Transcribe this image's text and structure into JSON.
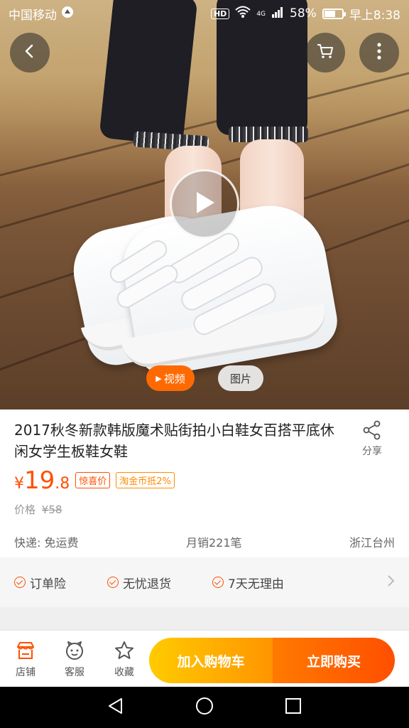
{
  "status_bar": {
    "carrier": "中国移动",
    "hd_badge": "HD",
    "network": "4G",
    "battery": "58%",
    "battery_level": 0.58,
    "time": "早上8:38"
  },
  "media": {
    "video_tab": "视频",
    "photo_tab": "图片"
  },
  "product": {
    "title": "2017秋冬新款韩版魔术贴街拍小白鞋女百搭平底休闲女学生板鞋女鞋",
    "share_label": "分享",
    "price_currency": "¥",
    "price_integer": "19",
    "price_decimal": ".8",
    "tags": [
      "惊喜价",
      "淘金币抵2%"
    ],
    "original_price_label": "价格",
    "original_price": "¥58",
    "shipping": "快递: 免运费",
    "monthly_sales": "月销221笔",
    "location": "浙江台州"
  },
  "services": [
    "订单险",
    "无忧退货",
    "7天无理由"
  ],
  "action_bar": {
    "shop": "店铺",
    "service": "客服",
    "favorite": "收藏",
    "add_to_cart": "加入购物车",
    "buy_now": "立即购买"
  },
  "colors": {
    "accent": "#ff5000",
    "cart_button": "#ffb400",
    "buy_button": "#ff6000"
  },
  "icons": [
    "back-icon",
    "cart-icon",
    "more-icon",
    "play-icon",
    "share-icon",
    "shop-icon",
    "service-icon",
    "star-icon",
    "nav-back-icon",
    "nav-home-icon",
    "nav-recents-icon"
  ]
}
